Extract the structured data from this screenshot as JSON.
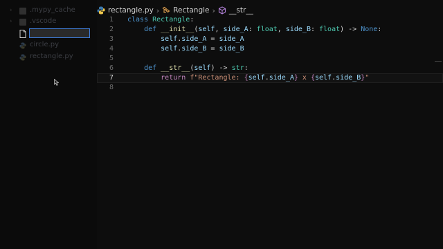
{
  "explorer": {
    "items": [
      {
        "name": ".mypy_cache",
        "kind": "folder"
      },
      {
        "name": ".vscode",
        "kind": "folder"
      },
      {
        "name": "",
        "kind": "new-file"
      },
      {
        "name": "circle.py",
        "kind": "py"
      },
      {
        "name": "rectangle.py",
        "kind": "py"
      }
    ],
    "rename_value": ""
  },
  "breadcrumb": {
    "file": "rectangle.py",
    "class": "Rectangle",
    "method": "__str__"
  },
  "code": {
    "line_numbers": [
      "1",
      "2",
      "3",
      "4",
      "5",
      "6",
      "7",
      "8"
    ],
    "lines": [
      [
        {
          "t": "class ",
          "c": "kw"
        },
        {
          "t": "Rectangle",
          "c": "cls"
        },
        {
          "t": ":",
          "c": "plain"
        }
      ],
      [
        {
          "t": "    def ",
          "c": "kw"
        },
        {
          "t": "__init__",
          "c": "fn"
        },
        {
          "t": "(",
          "c": "plain"
        },
        {
          "t": "self",
          "c": "var"
        },
        {
          "t": ", ",
          "c": "plain"
        },
        {
          "t": "side_A",
          "c": "var"
        },
        {
          "t": ": ",
          "c": "plain"
        },
        {
          "t": "float",
          "c": "typ"
        },
        {
          "t": ", ",
          "c": "plain"
        },
        {
          "t": "side_B",
          "c": "var"
        },
        {
          "t": ": ",
          "c": "plain"
        },
        {
          "t": "float",
          "c": "typ"
        },
        {
          "t": ") -> ",
          "c": "plain"
        },
        {
          "t": "None",
          "c": "none"
        },
        {
          "t": ":",
          "c": "plain"
        }
      ],
      [
        {
          "t": "        self",
          "c": "var"
        },
        {
          "t": ".",
          "c": "plain"
        },
        {
          "t": "side_A",
          "c": "var"
        },
        {
          "t": " = ",
          "c": "plain"
        },
        {
          "t": "side_A",
          "c": "var"
        }
      ],
      [
        {
          "t": "        self",
          "c": "var"
        },
        {
          "t": ".",
          "c": "plain"
        },
        {
          "t": "side_B",
          "c": "var"
        },
        {
          "t": " = ",
          "c": "plain"
        },
        {
          "t": "side_B",
          "c": "var"
        }
      ],
      [],
      [
        {
          "t": "    def ",
          "c": "kw"
        },
        {
          "t": "__str__",
          "c": "fn"
        },
        {
          "t": "(",
          "c": "plain"
        },
        {
          "t": "self",
          "c": "var"
        },
        {
          "t": ") -> ",
          "c": "plain"
        },
        {
          "t": "str",
          "c": "typ"
        },
        {
          "t": ":",
          "c": "plain"
        }
      ],
      [
        {
          "t": "        return ",
          "c": "brace"
        },
        {
          "t": "f\"Rectangle: ",
          "c": "str"
        },
        {
          "t": "{",
          "c": "brace"
        },
        {
          "t": "self",
          "c": "var"
        },
        {
          "t": ".",
          "c": "plain"
        },
        {
          "t": "side_A",
          "c": "var"
        },
        {
          "t": "}",
          "c": "brace"
        },
        {
          "t": " x ",
          "c": "str"
        },
        {
          "t": "{",
          "c": "brace"
        },
        {
          "t": "self",
          "c": "var"
        },
        {
          "t": ".",
          "c": "plain"
        },
        {
          "t": "side_B",
          "c": "var"
        },
        {
          "t": "}",
          "c": "brace"
        },
        {
          "t": "\"",
          "c": "str"
        }
      ],
      []
    ],
    "active_line": 7
  },
  "colors": {
    "accent": "#3e7bd6",
    "background": "#0d0d0d"
  }
}
